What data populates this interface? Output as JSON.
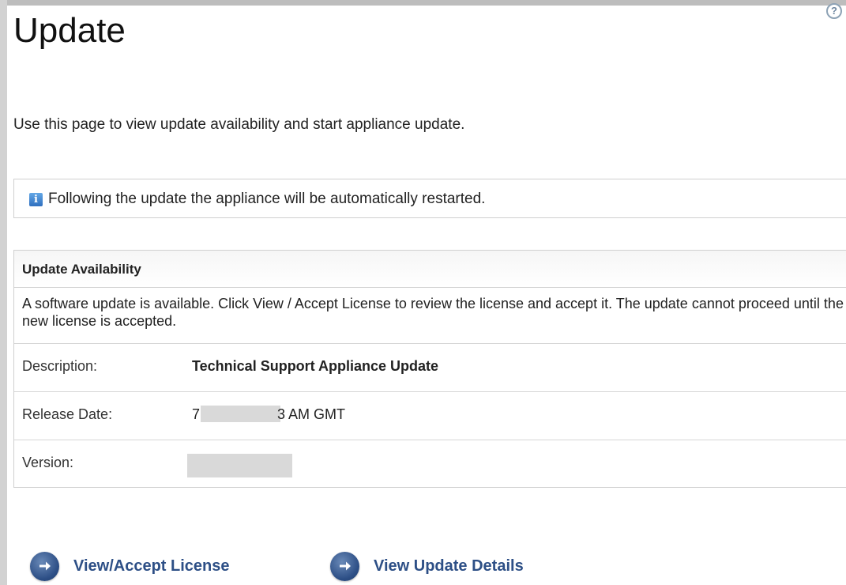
{
  "page": {
    "title": "Update",
    "help_icon_glyph": "?",
    "intro": "Use this page to view update availability and start appliance update."
  },
  "info_box": {
    "icon": "info-icon",
    "icon_glyph": "i",
    "text": "Following the update the appliance will be automatically restarted."
  },
  "availability": {
    "title": "Update Availability",
    "description": "A software update is available. Click View / Accept License to review the license and accept it. The update cannot proceed until the new license is accepted.",
    "rows": [
      {
        "label": "Description:",
        "value": "Technical Support Appliance Update"
      },
      {
        "label": "Release Date:",
        "value_prefix": "7",
        "value_suffix": "3 AM GMT"
      },
      {
        "label": "Version:",
        "value": ""
      }
    ]
  },
  "actions": [
    {
      "label": "View/Accept License",
      "icon": "arrow-right-circle-icon"
    },
    {
      "label": "View Update Details",
      "icon": "arrow-right-circle-icon"
    }
  ],
  "colors": {
    "link": "#2d4f86",
    "info_icon": "#2f6fbf",
    "border": "#cfcfcf",
    "redaction": "#d9d9d9"
  }
}
